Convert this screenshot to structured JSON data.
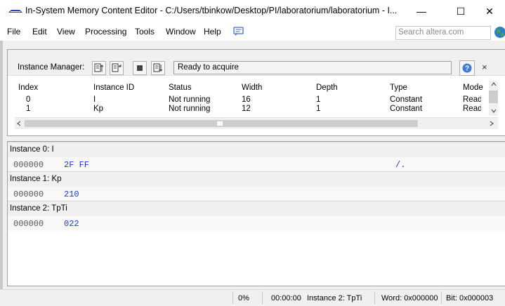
{
  "window": {
    "title": "In-System Memory Content Editor - C:/Users/tbinkow/Desktop/PI/laboratorium/laboratorium - I...",
    "minimize_glyph": "—",
    "maximize_glyph": "☐",
    "close_glyph": "✕"
  },
  "menu": {
    "items": [
      "File",
      "Edit",
      "View",
      "Processing",
      "Tools",
      "Window",
      "Help"
    ],
    "search_placeholder": "Search altera.com"
  },
  "instance_manager": {
    "label": "Instance Manager:",
    "status": "Ready to acquire",
    "close_glyph": "×",
    "columns": [
      "Index",
      "Instance ID",
      "Status",
      "Width",
      "Depth",
      "Type",
      "Mode"
    ],
    "rows": [
      [
        "0",
        "I",
        "Not running",
        "16",
        "1",
        "Constant",
        "Read"
      ],
      [
        "1",
        "Kp",
        "Not running",
        "12",
        "1",
        "Constant",
        "Read"
      ]
    ]
  },
  "memory": {
    "instances": [
      {
        "header": "Instance 0: I",
        "address": "000000",
        "value": "2F FF",
        "ascii": "/."
      },
      {
        "header": "Instance 1: Kp",
        "address": "000000",
        "value": "210",
        "ascii": ""
      },
      {
        "header": "Instance 2: TpTi",
        "address": "000000",
        "value": "022",
        "ascii": ""
      }
    ]
  },
  "statusbar": {
    "progress": "0%",
    "time": "00:00:00",
    "instance": "Instance 2: TpTi",
    "word": "Word: 0x000000",
    "bit": "Bit: 0x000003"
  },
  "colors": {
    "accent_blue": "#1a3cc8",
    "panel_bg": "#f0f0f0"
  }
}
